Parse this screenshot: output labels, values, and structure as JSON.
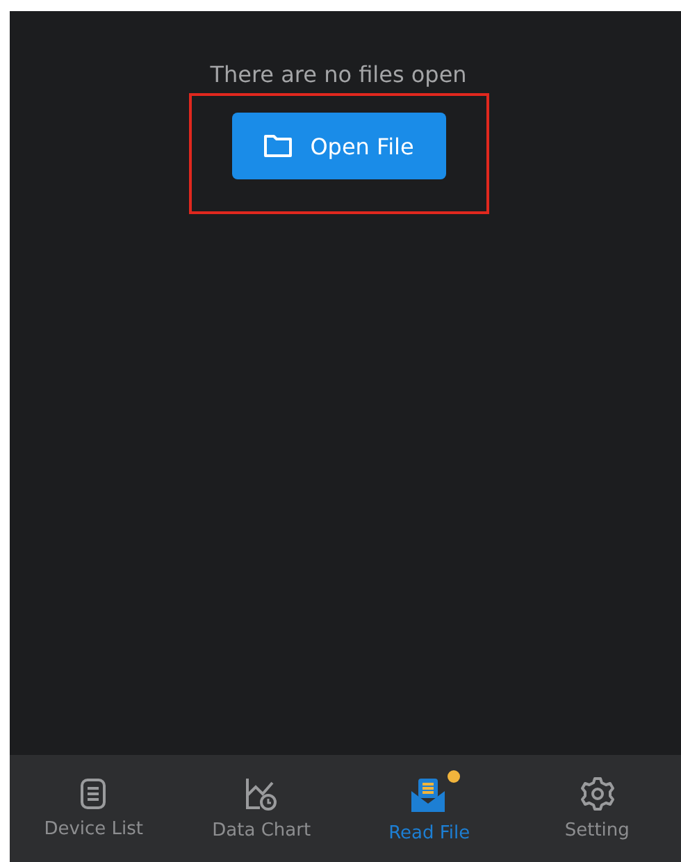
{
  "message": "There are no files open",
  "open_button": {
    "label": "Open File",
    "highlighted": true
  },
  "tabs": [
    {
      "label": "Device List",
      "kind": "list",
      "selected": false,
      "badge": false
    },
    {
      "label": "Data Chart",
      "kind": "chart",
      "selected": false,
      "badge": false
    },
    {
      "label": "Read File",
      "kind": "file",
      "selected": true,
      "badge": true
    },
    {
      "label": "Setting",
      "kind": "gear",
      "selected": false,
      "badge": false
    }
  ]
}
